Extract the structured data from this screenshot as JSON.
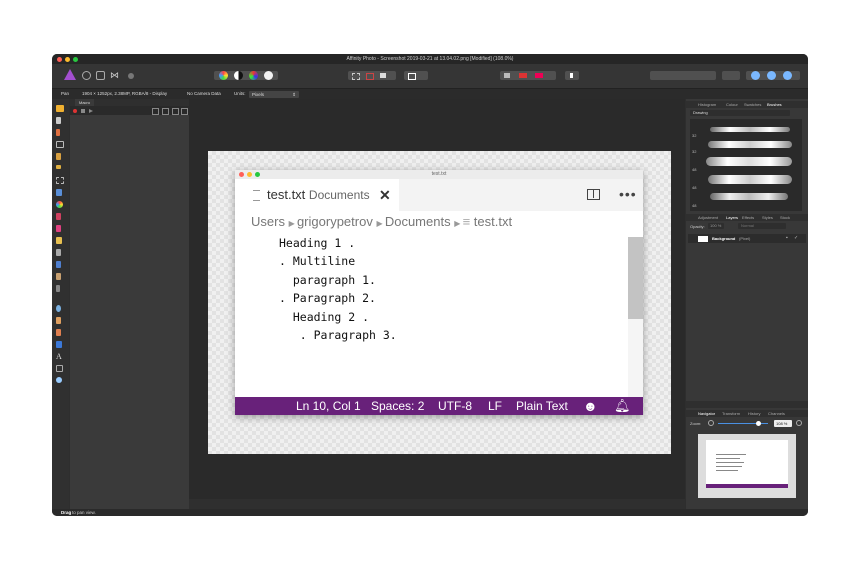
{
  "window": {
    "title": "Affinity Photo - Screenshot 2019-03-21 at 13.04.02.png [Modified] (108.0%)"
  },
  "context_toolbar": {
    "tool": "Pan",
    "image_info": "1904 × 1252px, 2.38MP, RGBA/8 - Display",
    "camera": "No Camera Data",
    "units_label": "Units:",
    "units_value": "Pixels"
  },
  "left_panel": {
    "tab": "Macro"
  },
  "right_panel": {
    "top_tabs": [
      "Histogram",
      "Colour",
      "Swatches",
      "Brushes"
    ],
    "brush_category": "Drawing",
    "brush_sizes": [
      "32",
      "32",
      "48",
      "48",
      "48"
    ],
    "mid_tabs": [
      "Adjustment",
      "Layers",
      "Effects",
      "Styles",
      "Stock"
    ],
    "opacity_label": "Opacity:",
    "opacity_value": "100 %",
    "blend_mode": "Normal",
    "layer_name": "Background",
    "layer_type": "(Pixel)",
    "bottom_tabs": [
      "Navigator",
      "Transform",
      "History",
      "Channels"
    ],
    "zoom_label": "Zoom:",
    "zoom_value": "108 %"
  },
  "canvas_doc": {
    "window_title": "test.txt",
    "tab_file": "test.txt",
    "tab_folder": "Documents",
    "breadcrumb": [
      "Users",
      "grigorypetrov",
      "Documents",
      "test.txt"
    ],
    "code_lines": [
      "Heading 1 .",
      ". Multiline",
      "  paragraph 1.",
      ". Paragraph 2.",
      "  Heading 2 .",
      "   . Paragraph 3."
    ],
    "status": {
      "position": "Ln 10, Col 1",
      "spaces": "Spaces: 2",
      "encoding": "UTF-8",
      "eol": "LF",
      "language": "Plain Text"
    }
  },
  "status_bar": {
    "bold": "Drag",
    "text": " to pan view."
  },
  "colors": {
    "vscode_status": "#68217a",
    "app_bg": "#2e2e2e"
  }
}
